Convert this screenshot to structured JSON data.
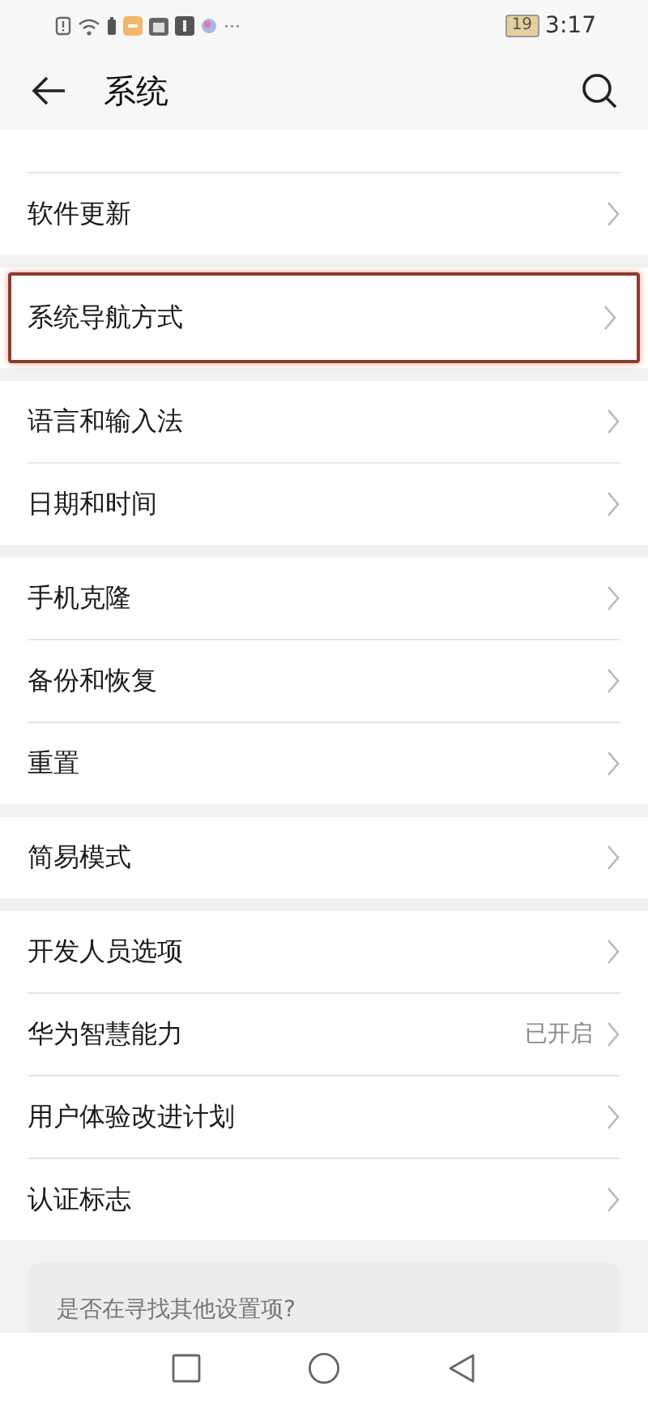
{
  "status_bar": {
    "battery": "19",
    "time": "3:17",
    "more": "···"
  },
  "header": {
    "title": "系统"
  },
  "groups": [
    {
      "items": [
        {
          "kind": "clipped"
        },
        {
          "kind": "row",
          "label": "软件更新",
          "highlighted": false
        }
      ]
    },
    {
      "items": [
        {
          "kind": "row",
          "label": "系统导航方式",
          "highlighted": true
        }
      ]
    },
    {
      "items": [
        {
          "kind": "row",
          "label": "语言和输入法",
          "highlighted": false
        },
        {
          "kind": "row",
          "label": "日期和时间",
          "highlighted": false
        }
      ]
    },
    {
      "items": [
        {
          "kind": "row",
          "label": "手机克隆",
          "highlighted": false
        },
        {
          "kind": "row",
          "label": "备份和恢复",
          "highlighted": false
        },
        {
          "kind": "row",
          "label": "重置",
          "highlighted": false
        }
      ]
    },
    {
      "items": [
        {
          "kind": "row",
          "label": "简易模式",
          "highlighted": false
        }
      ]
    },
    {
      "items": [
        {
          "kind": "row",
          "label": "开发人员选项",
          "highlighted": false
        },
        {
          "kind": "row",
          "label": "华为智慧能力",
          "value": "已开启",
          "highlighted": false
        },
        {
          "kind": "row",
          "label": "用户体验改进计划",
          "highlighted": false
        },
        {
          "kind": "row",
          "label": "认证标志",
          "highlighted": false
        }
      ]
    }
  ],
  "suggestion": {
    "text": "是否在寻找其他设置项?"
  }
}
